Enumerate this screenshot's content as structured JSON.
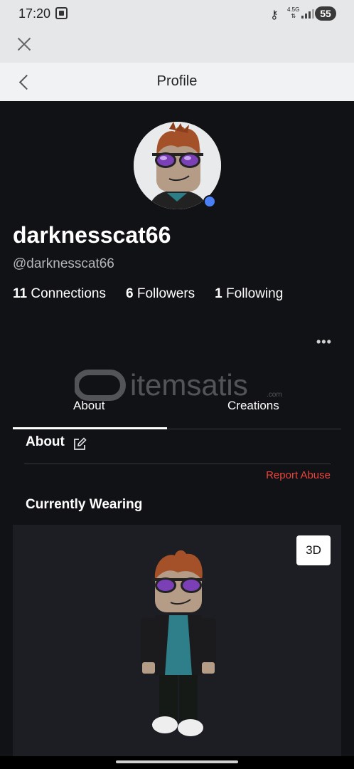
{
  "status_bar": {
    "time": "17:20",
    "network_label": "4.5G",
    "battery": "55",
    "icons": [
      "screenshot-icon",
      "vpn-key-icon",
      "network-type-icon",
      "signal-icon",
      "battery-icon"
    ]
  },
  "header": {
    "title": "Profile"
  },
  "profile": {
    "display_name": "darknesscat66",
    "handle": "@darknesscat66",
    "online_status_color": "#4b7ff6",
    "stats": [
      {
        "count": "11",
        "label": "Connections"
      },
      {
        "count": "6",
        "label": "Followers"
      },
      {
        "count": "1",
        "label": "Following"
      }
    ]
  },
  "watermark": {
    "text": "itemsatis",
    "suffix": ".com"
  },
  "tabs": [
    {
      "label": "About",
      "selected": true
    },
    {
      "label": "Creations",
      "selected": false
    }
  ],
  "about": {
    "title": "About",
    "report_label": "Report Abuse",
    "report_color": "#e8453c"
  },
  "wearing": {
    "title": "Currently Wearing",
    "view_toggle_label": "3D"
  },
  "colors": {
    "background": "#111216",
    "accent": "#4b7ff6"
  }
}
